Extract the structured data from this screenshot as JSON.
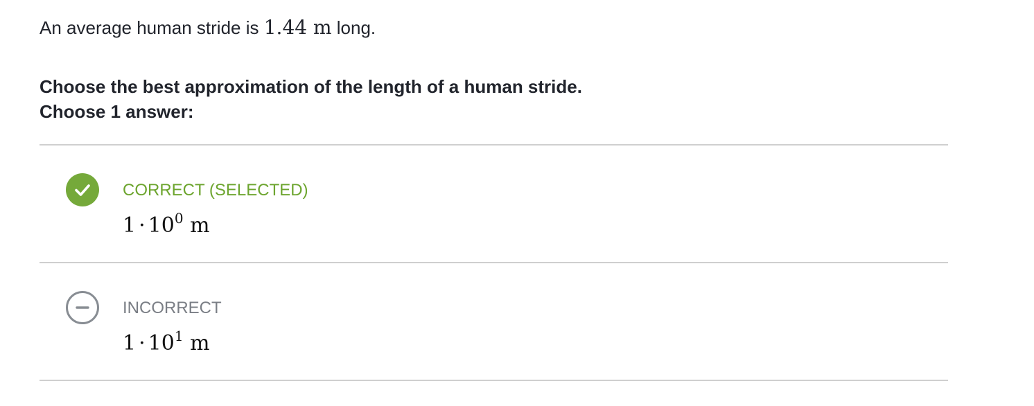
{
  "question": {
    "intro_before": "An average human stride is ",
    "intro_value": "1.44",
    "intro_unit": "m",
    "intro_after": " long.",
    "prompt": "Choose the best approximation of the length of a human stride.",
    "choose_count": "Choose 1 answer:"
  },
  "choices": [
    {
      "status": "CORRECT (SELECTED)",
      "coefficient": "1",
      "operator": "·",
      "base": "10",
      "exponent": "0",
      "unit": "m",
      "icon": "check-icon",
      "state": "correct",
      "color": "#75a93a"
    },
    {
      "status": "INCORRECT",
      "coefficient": "1",
      "operator": "·",
      "base": "10",
      "exponent": "1",
      "unit": "m",
      "icon": "minus-circle-icon",
      "state": "incorrect",
      "color": "#888d93"
    }
  ],
  "colors": {
    "text": "#21242c",
    "correct": "#75a93a",
    "incorrect": "#888d93",
    "divider": "#cfcfcf"
  }
}
